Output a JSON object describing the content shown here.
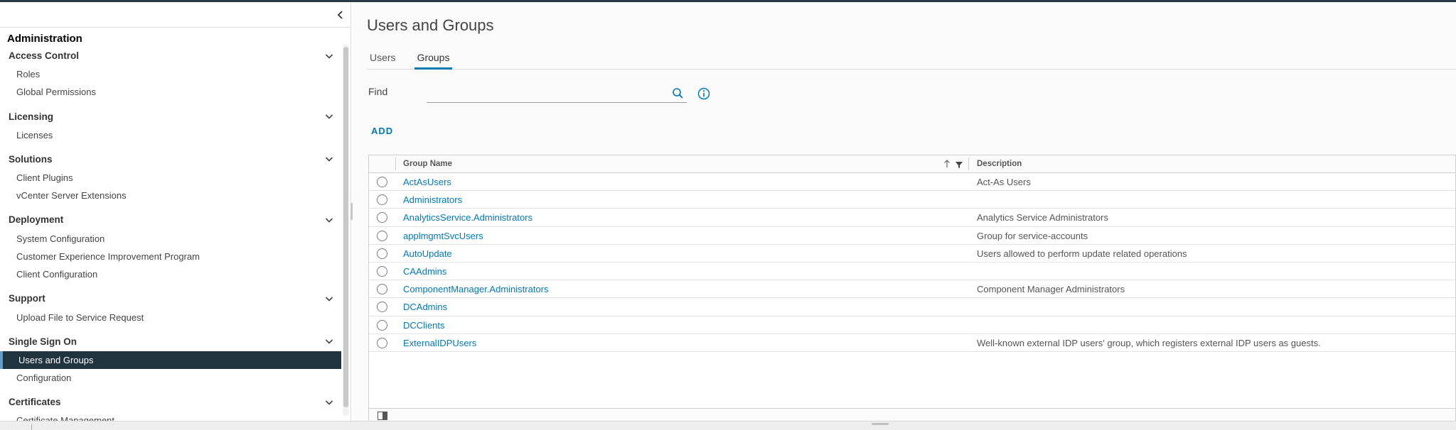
{
  "sidebar": {
    "title": "Administration",
    "groups": [
      {
        "label": "Access Control",
        "items": [
          "Roles",
          "Global Permissions"
        ]
      },
      {
        "label": "Licensing",
        "items": [
          "Licenses"
        ]
      },
      {
        "label": "Solutions",
        "items": [
          "Client Plugins",
          "vCenter Server Extensions"
        ]
      },
      {
        "label": "Deployment",
        "items": [
          "System Configuration",
          "Customer Experience Improvement Program",
          "Client Configuration"
        ]
      },
      {
        "label": "Support",
        "items": [
          "Upload File to Service Request"
        ]
      },
      {
        "label": "Single Sign On",
        "items": [
          "Users and Groups",
          "Configuration"
        ]
      },
      {
        "label": "Certificates",
        "items": [
          "Certificate Management"
        ]
      }
    ],
    "active_item": "Users and Groups"
  },
  "main": {
    "title": "Users and Groups",
    "tabs": [
      {
        "label": "Users",
        "active": false
      },
      {
        "label": "Groups",
        "active": true
      }
    ],
    "find_label": "Find",
    "find_value": "",
    "add_label": "ADD"
  },
  "grid": {
    "columns": [
      "Group Name",
      "Description"
    ],
    "rows": [
      {
        "name": "ActAsUsers",
        "description": "Act-As Users"
      },
      {
        "name": "Administrators",
        "description": ""
      },
      {
        "name": "AnalyticsService.Administrators",
        "description": "Analytics Service Administrators"
      },
      {
        "name": "applmgmtSvcUsers",
        "description": "Group for service-accounts"
      },
      {
        "name": "AutoUpdate",
        "description": "Users allowed to perform update related operations"
      },
      {
        "name": "CAAdmins",
        "description": ""
      },
      {
        "name": "ComponentManager.Administrators",
        "description": "Component Manager Administrators"
      },
      {
        "name": "DCAdmins",
        "description": ""
      },
      {
        "name": "DCClients",
        "description": ""
      },
      {
        "name": "ExternalIDPUsers",
        "description": "Well-known external IDP users' group, which registers external IDP users as guests."
      }
    ]
  },
  "colors": {
    "accent": "#0079b8",
    "active_nav_bg": "#1f3340",
    "active_nav_border": "#5a9fc7"
  },
  "icons": [
    "collapse-left-icon",
    "chevron-down-icon",
    "search-icon",
    "info-icon",
    "sort-ascending-icon",
    "filter-icon",
    "column-toggle-icon"
  ]
}
